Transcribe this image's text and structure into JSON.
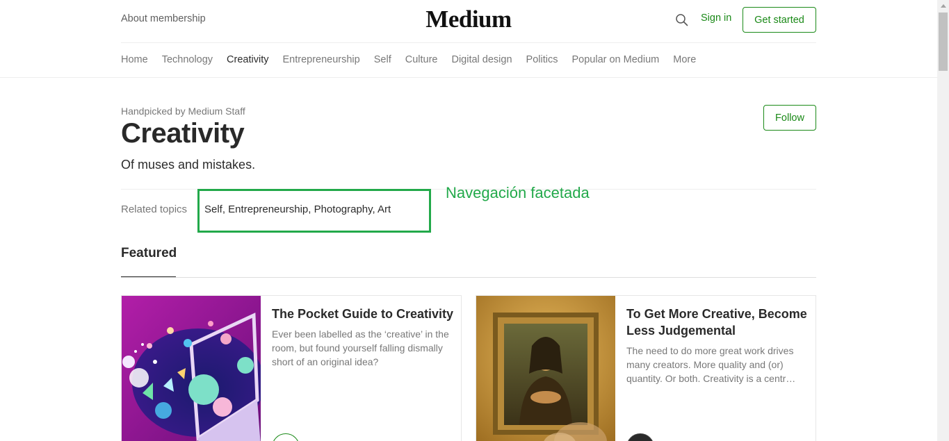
{
  "header": {
    "about_label": "About membership",
    "logo_text": "Medium",
    "search_icon": "search-icon",
    "signin_label": "Sign in",
    "getstarted_label": "Get started"
  },
  "nav": {
    "items": [
      "Home",
      "Technology",
      "Creativity",
      "Entrepreneurship",
      "Self",
      "Culture",
      "Digital design",
      "Politics",
      "Popular on Medium",
      "More"
    ],
    "active": "Creativity"
  },
  "topic": {
    "handpicked": "Handpicked by Medium Staff",
    "title": "Creativity",
    "subtitle": "Of muses and mistakes.",
    "follow_label": "Follow",
    "related_label": "Related topics",
    "related_values": "Self, Entrepreneurship, Photography, Art",
    "annotation": "Navegación facetada"
  },
  "featured": {
    "label": "Featured",
    "cards": [
      {
        "title": "The Pocket Guide to Creativity",
        "description": "Ever been labelled as the ‘creative’ in the room, but found yourself falling dismally short of an original idea?"
      },
      {
        "title": "To Get More Creative, Become Less Judgemental",
        "description": "The need to do more great work drives many creators. More quality and (or) quantity. Or both. Creativity is a centr…"
      }
    ]
  },
  "colors": {
    "accent": "#1a8917",
    "annotation": "#22a94a"
  }
}
